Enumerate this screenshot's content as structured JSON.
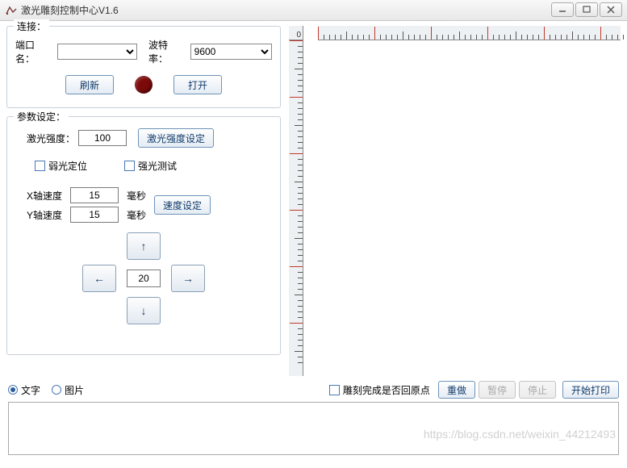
{
  "window": {
    "title": "激光雕刻控制中心V1.6"
  },
  "connection": {
    "legend": "连接：",
    "port_label": "端口名：",
    "port_value": "",
    "baud_label": "波特率：",
    "baud_value": "9600",
    "refresh_label": "刷新",
    "open_label": "打开"
  },
  "params": {
    "legend": "参数设定：",
    "laser_intensity_label": "激光强度：",
    "laser_intensity_value": "100",
    "laser_intensity_set_label": "激光强度设定",
    "weak_light_label": "弱光定位",
    "strong_light_label": "强光测试",
    "x_speed_label": "X轴速度",
    "x_speed_value": "15",
    "y_speed_label": "Y轴速度",
    "y_speed_value": "15",
    "ms_unit": "毫秒",
    "speed_set_label": "速度设定",
    "step_value": "20"
  },
  "preview": {
    "origin_label": "0"
  },
  "bottom": {
    "mode_text_label": "文字",
    "mode_image_label": "图片",
    "mode_selected": "text",
    "return_origin_label": "雕刻完成是否回原点",
    "redo_label": "重做",
    "pause_label": "暂停",
    "stop_label": "停止",
    "start_print_label": "开始打印"
  },
  "watermark": "https://blog.csdn.net/weixin_44212493"
}
